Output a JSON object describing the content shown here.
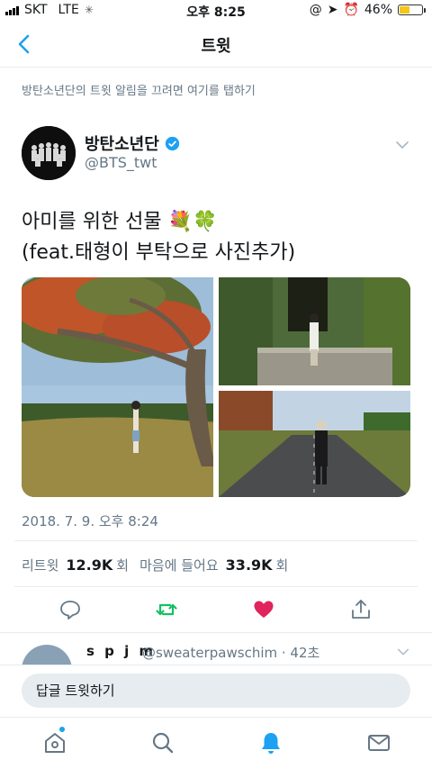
{
  "status_bar": {
    "carrier": "SKT",
    "network": "LTE",
    "time": "오후 8:25",
    "battery_percent": "46%",
    "battery_level": 0.46,
    "battery_color": "#f5c518"
  },
  "nav": {
    "title": "트윗",
    "back_icon": "chevron-left-icon"
  },
  "notice": "방탄소년단의 트윗 알림을 끄려면 여기를 탭하기",
  "tweet": {
    "author_name": "방탄소년단",
    "author_handle": "@BTS_twt",
    "text_line1": "아미를 위한 선물 💐🍀",
    "text_line2": "(feat.태형이 부탁으로 사진추가)",
    "timestamp": "2018. 7. 9. 오후 8:24",
    "retweet_label": "리트윗",
    "retweet_count": "12.9K",
    "retweet_suffix": "회",
    "like_label": "마음에 들어요",
    "like_count": "33.9K",
    "like_suffix": "회",
    "liked": true,
    "retweeted": false,
    "photo_count": 3
  },
  "reply_preview": {
    "name": "s p j m",
    "handle": "@sweaterpawschim · 42초"
  },
  "compose": {
    "placeholder": "답글 트윗하기"
  },
  "tabbar": {
    "items": [
      "home-icon",
      "search-icon",
      "notifications-icon",
      "messages-icon"
    ],
    "active": "notifications-icon"
  },
  "colors": {
    "accent": "#1da1f2",
    "retweet_green": "#17bf63",
    "like_red": "#e0245e",
    "secondary_text": "#657786"
  }
}
